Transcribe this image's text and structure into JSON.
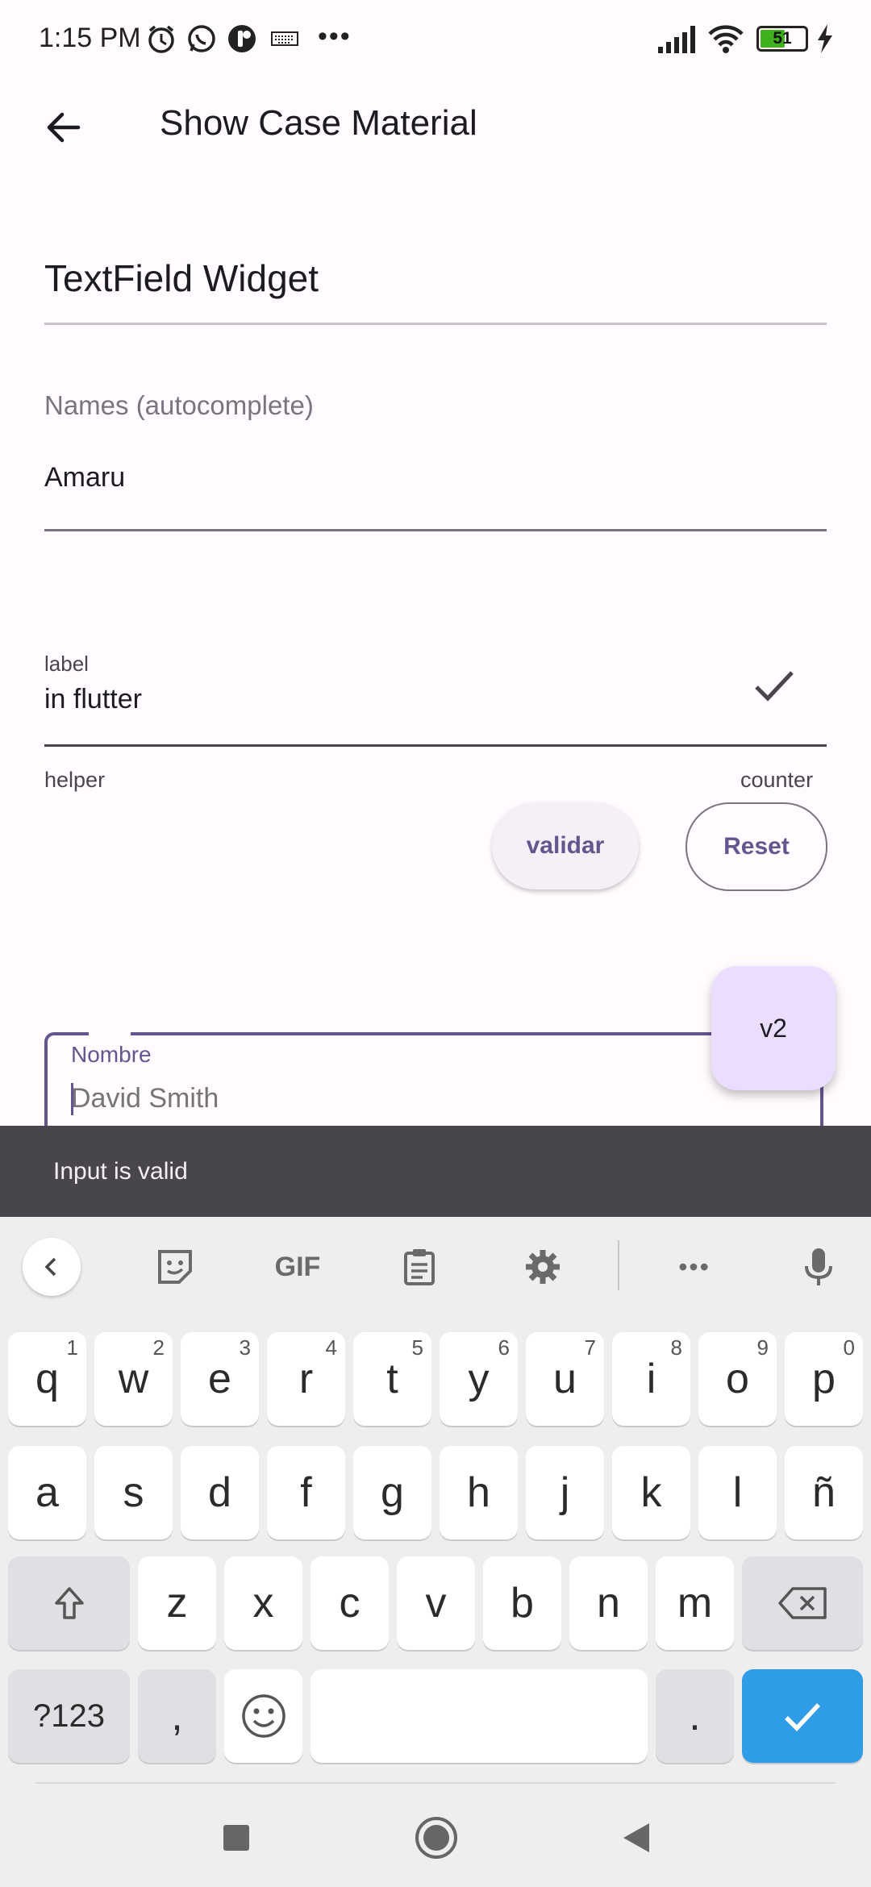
{
  "status_bar": {
    "time": "1:15 PM",
    "battery": "51"
  },
  "app_bar": {
    "title": "Show Case Material"
  },
  "content": {
    "section_title": "TextField Widget",
    "names_field": {
      "label": "Names (autocomplete)",
      "value": "Amaru"
    },
    "validated_field": {
      "label": "label",
      "value": "in flutter",
      "helper": "helper",
      "counter": "counter"
    },
    "buttons": {
      "validate_label": "validar",
      "reset_label": "Reset"
    },
    "fab_label": "v2",
    "nombre_field": {
      "label": "Nombre",
      "placeholder": "David Smith"
    }
  },
  "snackbar": {
    "message": "Input is valid"
  },
  "keyboard": {
    "row1": [
      {
        "key": "q",
        "hint": "1"
      },
      {
        "key": "w",
        "hint": "2"
      },
      {
        "key": "e",
        "hint": "3"
      },
      {
        "key": "r",
        "hint": "4"
      },
      {
        "key": "t",
        "hint": "5"
      },
      {
        "key": "y",
        "hint": "6"
      },
      {
        "key": "u",
        "hint": "7"
      },
      {
        "key": "i",
        "hint": "8"
      },
      {
        "key": "o",
        "hint": "9"
      },
      {
        "key": "p",
        "hint": "0"
      }
    ],
    "row2": [
      "a",
      "s",
      "d",
      "f",
      "g",
      "h",
      "j",
      "k",
      "l",
      "ñ"
    ],
    "row3": [
      "z",
      "x",
      "c",
      "v",
      "b",
      "n",
      "m"
    ],
    "symbols_label": "?123",
    "comma_label": ",",
    "period_label": ".",
    "toolbar": {
      "gif_label": "GIF"
    }
  },
  "colors": {
    "primary": "#65558f",
    "fab": "#eaddff",
    "snackbar": "#48464c",
    "enter_key": "#2e9ce6"
  }
}
